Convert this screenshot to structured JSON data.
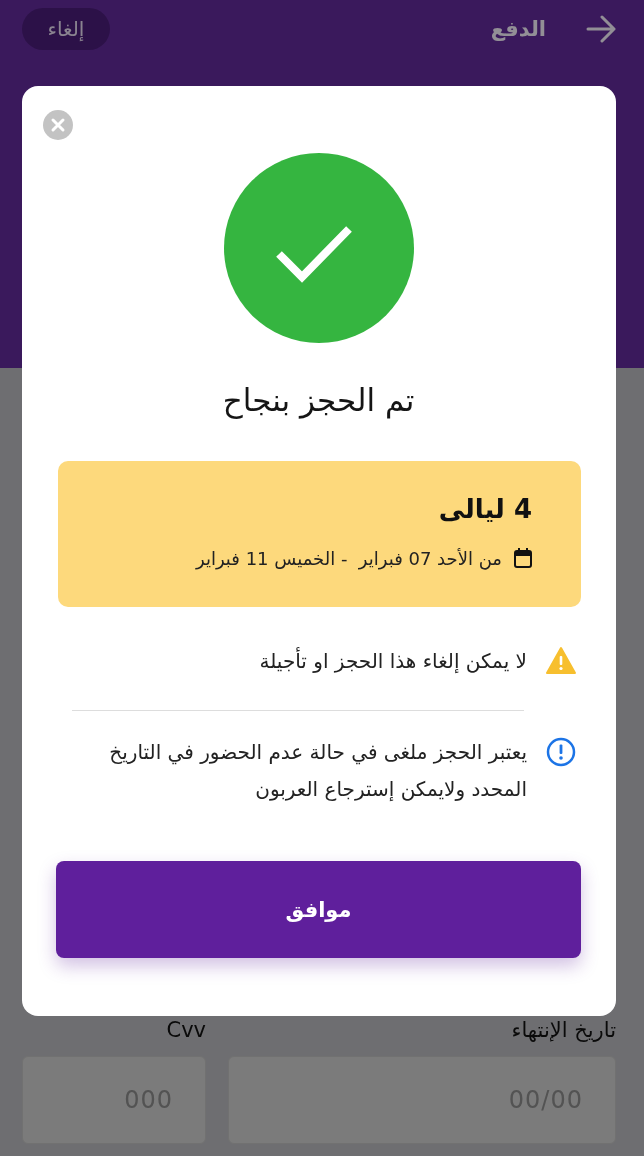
{
  "header": {
    "title": "الدفع",
    "cancel_button": "إلغاء"
  },
  "form": {
    "fields": [
      {
        "label": "تاريخ الإنتهاء",
        "placeholder": "00/00"
      },
      {
        "label": "Cvv",
        "placeholder": "000"
      }
    ]
  },
  "dialog": {
    "title": "تم الحجز بنجاح",
    "booking": {
      "nights": "4 ليالى",
      "dates": "من الأحد 07 فبراير  - الخميس 11 فبراير"
    },
    "notices": [
      {
        "kind": "warning",
        "text": "لا يمكن إلغاء هذا الحجز او تأجيلة"
      },
      {
        "kind": "info",
        "text": "يعتبر الحجز ملغى في حالة عدم الحضور في التاريخ المحدد ولايمكن إسترجاع العربون"
      }
    ],
    "confirm_button": "موافق"
  }
}
